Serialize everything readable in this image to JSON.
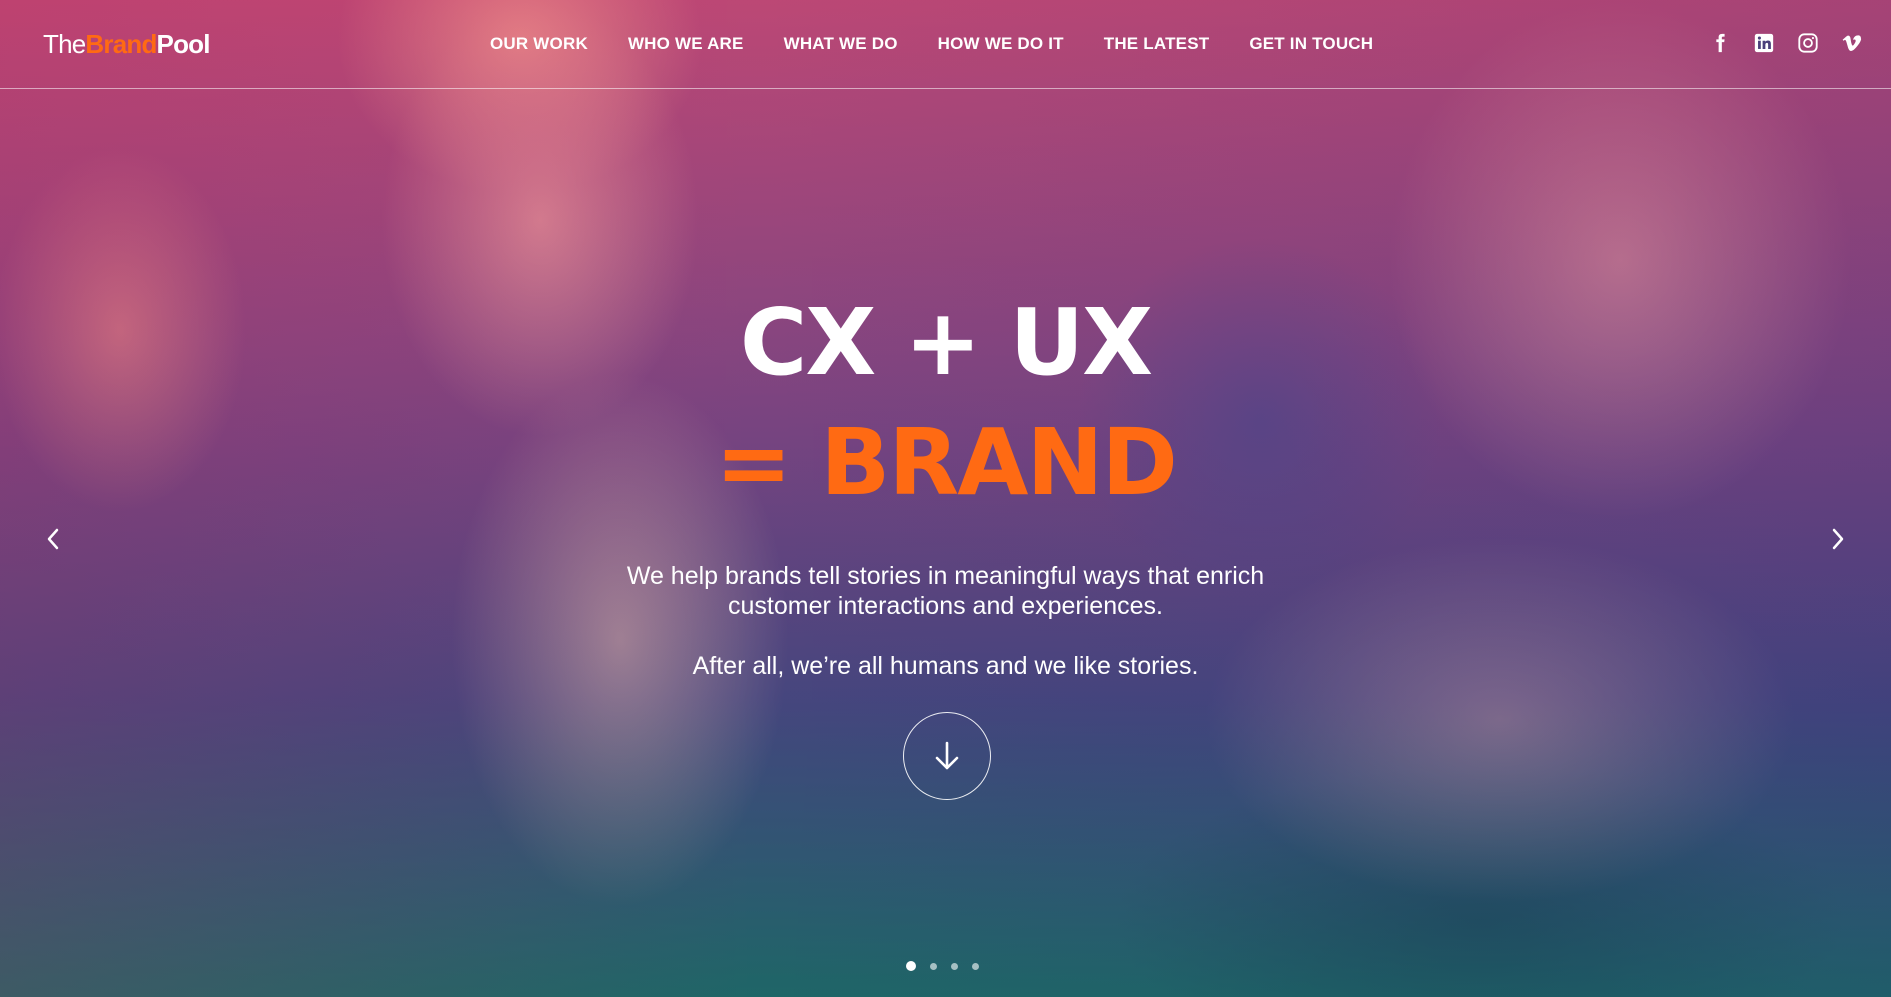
{
  "brand": {
    "logo_the": "The",
    "logo_brand": "Brand",
    "logo_pool": "Pool",
    "accent_color": "#ff6a13"
  },
  "nav": {
    "items": [
      {
        "label": "OUR WORK"
      },
      {
        "label": "WHO WE ARE"
      },
      {
        "label": "WHAT WE DO"
      },
      {
        "label": "HOW WE DO IT"
      },
      {
        "label": "THE LATEST"
      },
      {
        "label": "GET IN TOUCH"
      }
    ]
  },
  "social": {
    "icons": [
      "facebook-icon",
      "linkedin-icon",
      "instagram-icon",
      "vimeo-icon"
    ]
  },
  "hero": {
    "headline_line1": "CX + UX",
    "headline_line2": "= BRAND",
    "paragraph1_line1": "We help brands tell stories in meaningful ways that enrich",
    "paragraph1_line2": "customer interactions and experiences.",
    "paragraph2": "After all, we’re all humans and we like stories.",
    "scroll_icon": "arrow-down-icon",
    "prev_icon": "chevron-left-icon",
    "next_icon": "chevron-right-icon"
  },
  "slider": {
    "total_slides": 4,
    "active_slide": 1
  }
}
